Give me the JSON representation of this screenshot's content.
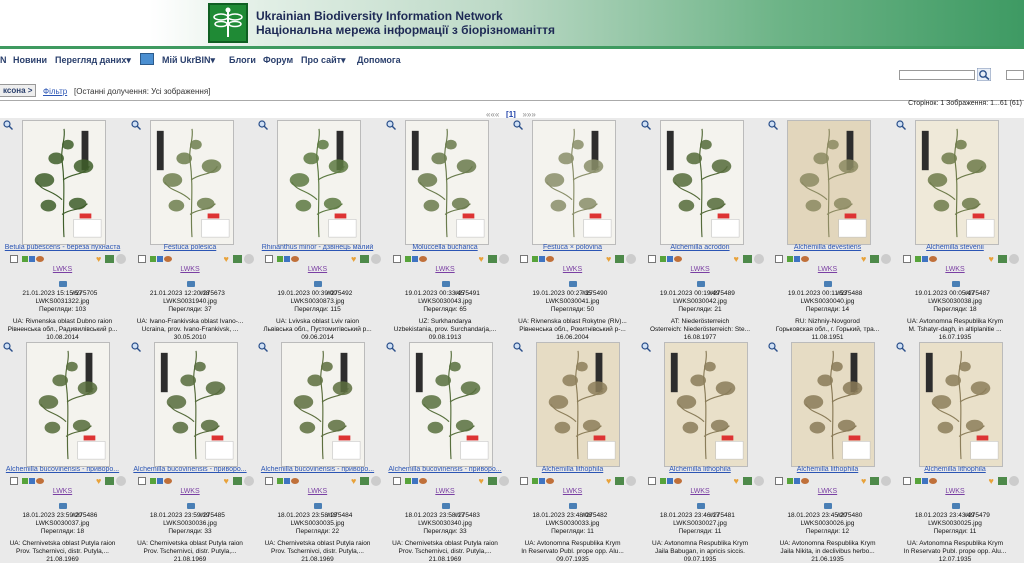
{
  "header": {
    "title_en": "Ukrainian Biodiversity Information Network",
    "title_uk": "Національна мережа інформації з біорізноманіття"
  },
  "menu": {
    "items": [
      "N",
      "Новини",
      "Перегляд даних",
      "Мій UkrBIN",
      "Блоги",
      "Форум",
      "Про сайт",
      "Допомога"
    ]
  },
  "tabs": {
    "active": "ксона >",
    "filter": "Фільтр",
    "crumb": "[Останні долучення: Усі зображення]"
  },
  "stats": "Сторінок: 1    Зображення: 1...61 (61)",
  "pager": {
    "prev": "«««",
    "current": "[1]",
    "next": "»»»"
  },
  "colors": {
    "accent_green": "#3e9a63",
    "link_blue": "#2b55b4",
    "inst_purple": "#7a3fa3"
  },
  "records": [
    {
      "name": "Betula pubescens - береза пухнаста",
      "inst": "LWKS",
      "date": "21.01.2023 15:15:57",
      "id": "#275705",
      "file": "LWKS0031322.jpg",
      "views": "Перегляди: 103",
      "loc1": "UA: Rivnenska oblast Dubno raion",
      "loc2": "Рівненська обл., Радивилівський р...",
      "coll": "10.08.2014"
    },
    {
      "name": "Festuca polesica",
      "inst": "LWKS",
      "date": "21.01.2023 12:20:18",
      "id": "#275673",
      "file": "LWKS0031940.jpg",
      "views": "Перегляди: 37",
      "loc1": "UA: Ivano-Frankivska oblast Ivano-...",
      "loc2": "Ucraina, prov. Ivano-Frankivsk, ...",
      "coll": "30.05.2010"
    },
    {
      "name": "Rhinanthus minor - дзвінець малий",
      "inst": "LWKS",
      "date": "19.01.2023 00:39:00",
      "id": "#275492",
      "file": "LWKS0030873.jpg",
      "views": "Перегляди: 115",
      "loc1": "UA: Lvivska oblast Lviv raion",
      "loc2": "Львівська обл., Пустомитівський р...",
      "coll": "09.06.2014"
    },
    {
      "name": "Moluccella bucharica",
      "inst": "LWKS",
      "date": "19.01.2023 00:33:45",
      "id": "#275491",
      "file": "LWKS0030043.jpg",
      "views": "Перегляди: 65",
      "loc1": "UZ: Surkhandarya",
      "loc2": "Uzbekistania, prov. Surchandarja,...",
      "coll": "09.08.1913"
    },
    {
      "name": "Festuca × polovina",
      "inst": "LWKS",
      "date": "19.01.2023 00:27:35",
      "id": "#275490",
      "file": "LWKS0030041.jpg",
      "views": "Перегляди: 50",
      "loc1": "UA: Rivnenska oblast Rokytne (Rlv)...",
      "loc2": "Рівненська обл., Рокитнівський р-...",
      "coll": "16.06.2004"
    },
    {
      "name": "Alchemilla acrodon",
      "inst": "LWKS",
      "date": "19.01.2023 00:19:49",
      "id": "#275489",
      "file": "LWKS0030042.jpg",
      "views": "Перегляди: 21",
      "loc1": "AT: Niederösterreich",
      "loc2": "Österreich: Niederösterreich: Ste...",
      "coll": "16.08.1977"
    },
    {
      "name": "Alchemilla devestiens",
      "inst": "LWKS",
      "date": "19.01.2023 00:11:53",
      "id": "#275488",
      "file": "LWKS0030040.jpg",
      "views": "Перегляди: 14",
      "loc1": "RU: Nizhniy-Novgorod",
      "loc2": "Горьковская обл., г. Горький, тра...",
      "coll": "11.08.1951"
    },
    {
      "name": "Alchemilla stevenii",
      "inst": "LWKS",
      "date": "19.01.2023 00:05:47",
      "id": "#275487",
      "file": "LWKS0030038.jpg",
      "views": "Перегляди: 18",
      "loc1": "UA: Avtonomna Respublika Krym",
      "loc2": "M. Tshatyr-dagh, in altiplanitie ...",
      "coll": "16.07.1935"
    },
    {
      "name": "Alchemilla bucovinensis - приворо...",
      "inst": "LWKS",
      "date": "18.01.2023 23:59:20",
      "id": "#275486",
      "file": "LWKS0030037.jpg",
      "views": "Перегляди: 18",
      "loc1": "UA: Chernivetska oblast Putyla raion",
      "loc2": "Prov. Tschernivci, distr. Putyla,...",
      "coll": "21.08.1969"
    },
    {
      "name": "Alchemilla bucovinensis - приворо...",
      "inst": "LWKS",
      "date": "18.01.2023 23:59:19",
      "id": "#275485",
      "file": "LWKS0030036.jpg",
      "views": "Перегляди: 33",
      "loc1": "UA: Chernivetska oblast Putyla raion",
      "loc2": "Prov. Tschernivci, distr. Putyla,...",
      "coll": "21.08.1969"
    },
    {
      "name": "Alchemilla bucovinensis - приворо...",
      "inst": "LWKS",
      "date": "18.01.2023 23:58:18",
      "id": "#275484",
      "file": "LWKS0030035.jpg",
      "views": "Перегляди: 22",
      "loc1": "UA: Chernivetska oblast Putyla raion",
      "loc2": "Prov. Tschernivci, distr. Putyla,...",
      "coll": "21.08.1969"
    },
    {
      "name": "Alchemilla bucovinensis - приворо...",
      "inst": "LWKS",
      "date": "18.01.2023 23:58:17",
      "id": "#275483",
      "file": "LWKS0030340.jpg",
      "views": "Перегляди: 33",
      "loc1": "UA: Chernivetska oblast Putyla raion",
      "loc2": "Prov. Tschernivci, distr. Putyla,...",
      "coll": "21.08.1969"
    },
    {
      "name": "Alchemilla lithophila",
      "inst": "LWKS",
      "date": "18.01.2023 23:48:08",
      "id": "#275482",
      "file": "LWKS0030033.jpg",
      "views": "Перегляди: 11",
      "loc1": "UA: Avtonomna Respublika Krym",
      "loc2": "In Reservato Publ. prope opp. Alu...",
      "coll": "09.07.1935"
    },
    {
      "name": "Alchemilla lithophila",
      "inst": "LWKS",
      "date": "18.01.2023 23:46:17",
      "id": "#275481",
      "file": "LWKS0030027.jpg",
      "views": "Перегляди: 11",
      "loc1": "UA: Avtonomna Respublika Krym",
      "loc2": "Jaila Babugan, in apricis siccis.",
      "coll": "09.07.1935"
    },
    {
      "name": "Alchemilla lithophila",
      "inst": "LWKS",
      "date": "18.01.2023 23:45:20",
      "id": "#275480",
      "file": "LWKS0030026.jpg",
      "views": "Перегляди: 12",
      "loc1": "UA: Avtonomna Respublika Krym",
      "loc2": "Jaila Nikita, in declivibus herbo...",
      "coll": "21.06.1935"
    },
    {
      "name": "Alchemilla lithophila",
      "inst": "LWKS",
      "date": "18.01.2023 23:43:49",
      "id": "#275479",
      "file": "LWKS0030025.jpg",
      "views": "Перегляди: 11",
      "loc1": "UA: Avtonomna Respublika Krym",
      "loc2": "In Reservato Publ. prope opp. Alu...",
      "coll": "12.07.1935"
    }
  ]
}
